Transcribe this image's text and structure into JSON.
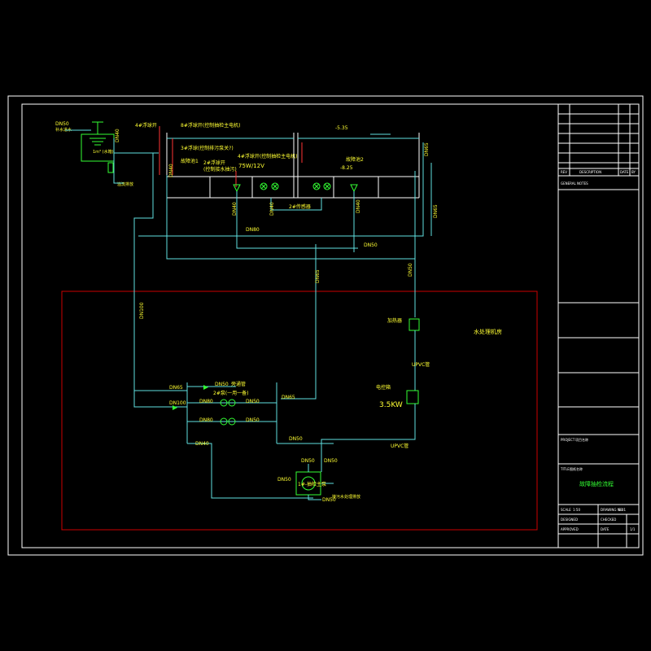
{
  "drawing": {
    "title": "故障抽检流程",
    "area_label": "水处理机房",
    "colors": {
      "background": "#000000",
      "frame": "#ffffff",
      "pipe": "#5fe0e0",
      "label": "#ffff33",
      "title": "#33ff33",
      "boundary": "#cc0000"
    }
  },
  "labels": {
    "dn50_top": "DN50",
    "dn50_top_sub": "补水进水",
    "tank_note": "1m³\n(水箱)",
    "dn40_tank": "DN40",
    "overflow_note": "溢流排放",
    "float_4": "4#浮球开",
    "float_8": "8#浮球开(控制抽检主电机)",
    "float_3": "3#浮球(控制排污泵关?)",
    "pool1": "故障池1",
    "float_2a": "2#浮球开",
    "float_2b": "(控制接水抽污)",
    "float_4b": "4#浮球开(控制抽检主电机)",
    "power": "75W/12V",
    "level_top": "-5.35",
    "level_mid": "-8.25",
    "pool2": "故障池2",
    "sensor_2": "2#传感器",
    "dn40_a": "DN40",
    "dn40_b": "DN40",
    "dn40_c": "DN40",
    "dn40_d": "DN40",
    "dn65_r": "DN65",
    "dn65_r2": "DN65",
    "dn80": "DN80",
    "dn50_mid": "DN50",
    "dn50_v": "DN50",
    "dn100_v": "DN100",
    "heater": "加热器",
    "upvc_1": "UPVC管",
    "control": "电控箱",
    "kw": "3.5KW",
    "upvc_2": "UPVC管",
    "dn65_manifold": "DN65",
    "dn50_bypass": "DN50",
    "bypass_note": "旁通管",
    "dn100_manifold": "DN100",
    "dn80_a": "DN80",
    "pump_note": "2#泵(一用一备)",
    "dn50_a": "DN50",
    "dn80_b": "DN80",
    "dn50_b": "DN50",
    "dn65_right": "DN65",
    "dn40_bottom": "DN40",
    "dn50_low": "DN50",
    "dn50_pump_a": "DN50",
    "dn50_pump_b": "DN50",
    "dn50_side": "DN50",
    "pump_label": "1#-抽检主泵",
    "dn50_out": "DN50",
    "out_note": "接污水处理排放"
  },
  "title_block": {
    "header_left": "REV",
    "header_mid": "DESCRIPTION",
    "header_date": "DATE",
    "header_by": "BY",
    "general_notes": "GENERAL NOTES",
    "project": "PROJECT",
    "project_name": "项目名称",
    "title_label": "TITLE",
    "title_value": "图纸名称",
    "scale_label": "SCALE",
    "scale_value": "1:50",
    "drawing_no_label": "DRAWING NO.",
    "drawing_no": "S-01",
    "designed": "DESIGNED",
    "checked": "CHECKED",
    "approved": "APPROVED",
    "date_label": "DATE",
    "sheet": "1/1"
  }
}
